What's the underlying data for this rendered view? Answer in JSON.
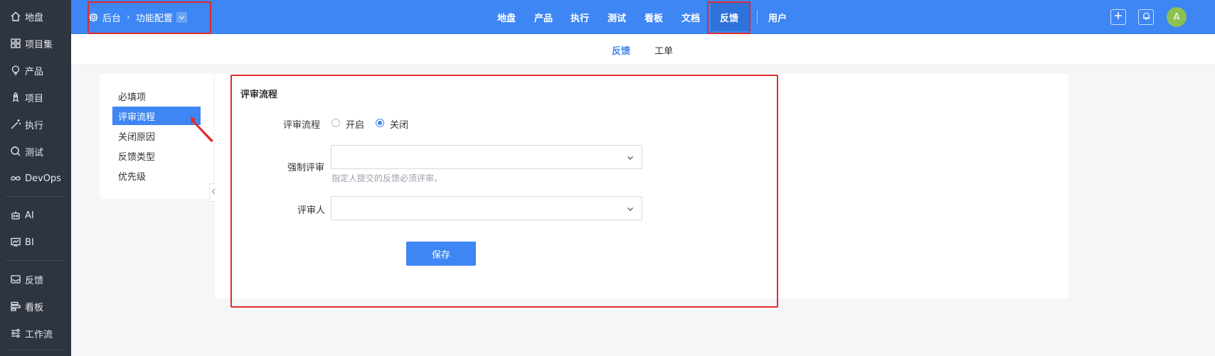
{
  "sidebar": {
    "items": [
      {
        "label": "地盘",
        "icon": "home-icon"
      },
      {
        "label": "项目集",
        "icon": "grid-icon"
      },
      {
        "label": "产品",
        "icon": "lightbulb-icon"
      },
      {
        "label": "项目",
        "icon": "rocket-icon"
      },
      {
        "label": "执行",
        "icon": "wand-icon"
      },
      {
        "label": "测试",
        "icon": "search-icon"
      },
      {
        "label": "DevOps",
        "icon": "infinity-icon"
      },
      {
        "label": "AI",
        "icon": "robot-icon"
      },
      {
        "label": "BI",
        "icon": "chart-board-icon"
      },
      {
        "label": "反馈",
        "icon": "inbox-icon"
      },
      {
        "label": "看板",
        "icon": "kanban-icon"
      },
      {
        "label": "工作流",
        "icon": "workflow-icon"
      }
    ]
  },
  "header": {
    "breadcrumb": {
      "root": "后台",
      "current": "功能配置"
    },
    "nav": [
      "地盘",
      "产品",
      "执行",
      "测试",
      "看板",
      "文档",
      "反馈",
      "用户"
    ],
    "active_nav": "反馈",
    "avatar_letter": "A"
  },
  "subnav": {
    "tabs": [
      "反馈",
      "工单"
    ],
    "active": "反馈"
  },
  "settings_menu": {
    "items": [
      "必填项",
      "评审流程",
      "关闭原因",
      "反馈类型",
      "优先级"
    ],
    "active": "评审流程"
  },
  "form": {
    "section_title": "评审流程",
    "review_process_label": "评审流程",
    "options": {
      "enable": "开启",
      "disable": "关闭"
    },
    "selected_option": "关闭",
    "forced_review_label": "强制评审",
    "forced_review_hint": "指定人提交的反馈必须评审。",
    "reviewer_label": "评审人",
    "save_label": "保存"
  },
  "colors": {
    "primary": "#3d86f3",
    "sidebar_bg": "#2e3541",
    "annotation": "#e02b2b"
  }
}
